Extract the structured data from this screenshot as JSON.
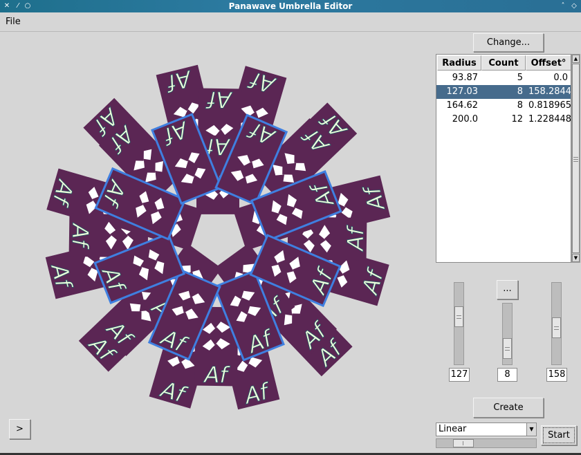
{
  "window": {
    "title": "Panawave Umbrella Editor"
  },
  "menu": {
    "file": "File"
  },
  "canvas": {
    "tile_text": "Af",
    "tile_color": "#5b2654",
    "glyph_color": "#f2ffdc",
    "highlight_color": "#3f7fe0"
  },
  "buttons": {
    "change": "Change...",
    "more": "...",
    "create": "Create",
    "start": "Start",
    "expand": ">"
  },
  "table": {
    "headers": [
      "Radius",
      "Count",
      "Offset°"
    ],
    "rows": [
      [
        "93.87",
        "5",
        "0.0"
      ],
      [
        "127.03",
        "8",
        "158.2844"
      ],
      [
        "164.62",
        "8",
        "0.818965"
      ],
      [
        "200.0",
        "12",
        "1.228448"
      ]
    ],
    "selected_row": 1
  },
  "sliders": {
    "radius_value": "127",
    "count_value": "8",
    "offset_value": "158"
  },
  "mode": {
    "selected": "Linear"
  }
}
